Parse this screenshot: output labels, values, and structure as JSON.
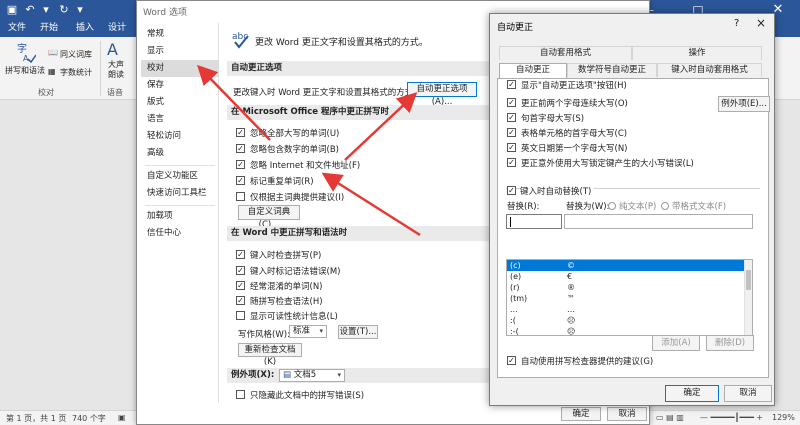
{
  "word": {
    "ribbon_tabs": [
      "文件",
      "开始",
      "插入",
      "设计"
    ],
    "ribbon": {
      "spell_check": "拼写和语法",
      "thesaurus": "同义词库",
      "word_count": "字数统计",
      "read_aloud_1": "大声",
      "read_aloud_2": "朗读",
      "group_proofing": "校对",
      "group_speech": "语音"
    },
    "status": {
      "page": "第 1 页，共 1 页",
      "words": "740 个字",
      "zoom": "129%"
    }
  },
  "options": {
    "title": "Word 选项",
    "nav": [
      "常规",
      "显示",
      "校对",
      "保存",
      "版式",
      "语言",
      "轻松访问",
      "高级",
      "自定义功能区",
      "快速访问工具栏",
      "加载项",
      "信任中心"
    ],
    "active_nav": 2,
    "heading": "更改 Word 更正文字和设置其格式的方式。",
    "section_autocorrect": "自动更正选项",
    "autocorrect_desc": "更改键入时 Word 更正文字和设置其格式的方式:",
    "autocorrect_btn": "自动更正选项(A)...",
    "section_office": "在 Microsoft Office 程序中更正拼写时",
    "office_checks": [
      {
        "label": "忽略全部大写的单词(U)",
        "checked": true
      },
      {
        "label": "忽略包含数字的单词(B)",
        "checked": true
      },
      {
        "label": "忽略 Internet 和文件地址(F)",
        "checked": true
      },
      {
        "label": "标记重复单词(R)",
        "checked": true
      },
      {
        "label": "仅根据主词典提供建议(I)",
        "checked": false
      }
    ],
    "custom_dict_btn": "自定义词典(C)...",
    "section_word": "在 Word 中更正拼写和语法时",
    "word_checks": [
      {
        "label": "键入时检查拼写(P)",
        "checked": true
      },
      {
        "label": "键入时标记语法错误(M)",
        "checked": true
      },
      {
        "label": "经常混淆的单词(N)",
        "checked": true
      },
      {
        "label": "随拼写检查语法(H)",
        "checked": true
      },
      {
        "label": "显示可读性统计信息(L)",
        "checked": false
      }
    ],
    "writing_style_label": "写作风格(W):",
    "writing_style_value": "标准",
    "settings_btn": "设置(T)...",
    "recheck_btn": "重新检查文档(K)",
    "exceptions_label": "例外项(X):",
    "exceptions_value": "文档5",
    "exceptions_check": "只隐藏此文档中的拼写错误(S)",
    "ok": "确定",
    "cancel": "取消"
  },
  "autocorrect": {
    "title": "自动更正",
    "help": "?",
    "close": "×",
    "tabs_back": [
      "自动套用格式",
      "操作"
    ],
    "tabs_front": [
      "自动更正",
      "数学符号自动更正",
      "键入时自动套用格式"
    ],
    "active_tab": 0,
    "checks": [
      {
        "label": "显示\"自动更正选项\"按钮(H)",
        "checked": true
      },
      {
        "label": "更正前两个字母连续大写(O)",
        "checked": true
      },
      {
        "label": "句首字母大写(S)",
        "checked": true
      },
      {
        "label": "表格单元格的首字母大写(C)",
        "checked": true
      },
      {
        "label": "英文日期第一个字母大写(N)",
        "checked": true
      },
      {
        "label": "更正意外使用大写锁定键产生的大小写错误(L)",
        "checked": true
      }
    ],
    "exceptions_btn": "例外项(E)...",
    "replace_as_type": {
      "label": "键入时自动替换(T)",
      "checked": true
    },
    "replace_label": "替换(R):",
    "with_label": "替换为(W):",
    "plain_text": "纯文本(P)",
    "formatted_text": "带格式文本(F)",
    "entries": [
      {
        "from": "(c)",
        "to": "©"
      },
      {
        "from": "(e)",
        "to": "€"
      },
      {
        "from": "(r)",
        "to": "®"
      },
      {
        "from": "(tm)",
        "to": "™"
      },
      {
        "from": "...",
        "to": "…"
      },
      {
        "from": ":(",
        "to": "☹"
      },
      {
        "from": ":-(",
        "to": "☹"
      }
    ],
    "add_btn": "添加(A)",
    "delete_btn": "删除(D)",
    "suggest_check": {
      "label": "自动使用拼写检查器提供的建议(G)",
      "checked": true
    },
    "ok": "确定",
    "cancel": "取消"
  }
}
